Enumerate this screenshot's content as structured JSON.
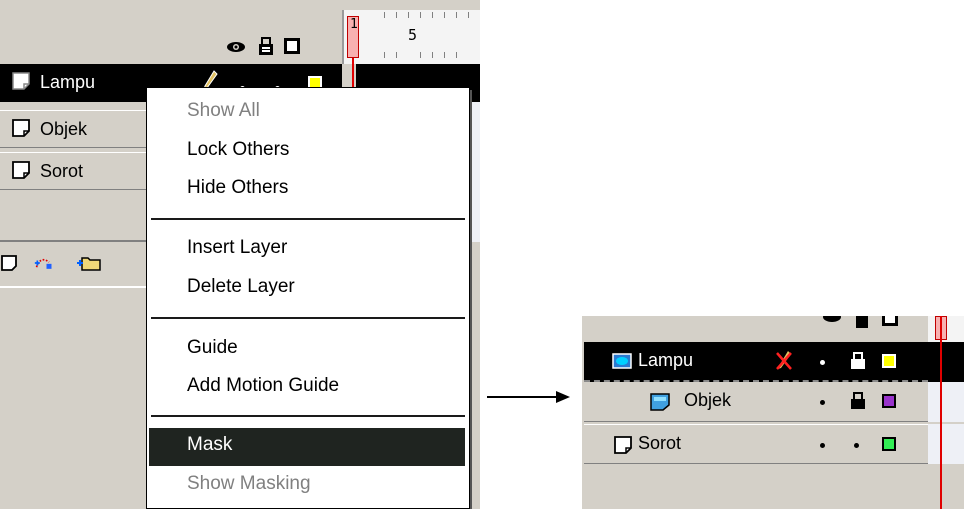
{
  "timeline": {
    "frame_label_1": "1",
    "frame_label_5": "5",
    "layers": [
      {
        "name": "Lampu"
      },
      {
        "name": "Objek"
      },
      {
        "name": "Sorot"
      }
    ]
  },
  "context_menu": {
    "items": [
      {
        "label": "Show All",
        "state": "disabled"
      },
      {
        "label": "Lock Others",
        "state": "normal"
      },
      {
        "label": "Hide Others",
        "state": "normal"
      },
      {
        "label": "Insert Layer",
        "state": "normal"
      },
      {
        "label": "Delete Layer",
        "state": "normal"
      },
      {
        "label": "Guide",
        "state": "normal"
      },
      {
        "label": "Add Motion Guide",
        "state": "normal"
      },
      {
        "label": "Mask",
        "state": "selected"
      },
      {
        "label": "Show Masking",
        "state": "disabled"
      }
    ]
  },
  "result_panel": {
    "layers": [
      {
        "name": "Lampu",
        "type": "mask",
        "color": "#ffff00"
      },
      {
        "name": "Objek",
        "type": "masked",
        "color": "#9933cc"
      },
      {
        "name": "Sorot",
        "type": "normal",
        "color": "#33ee55"
      }
    ]
  },
  "colors": {
    "panel_gray": "#d4d0c8",
    "selection": "#1f2420",
    "playhead": "#e00000",
    "lampu_swatch": "#ffff00"
  }
}
